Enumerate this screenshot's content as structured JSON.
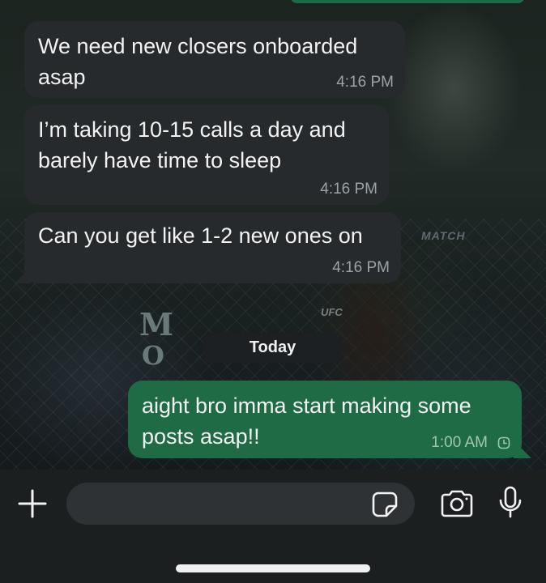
{
  "chat": {
    "messages": [
      {
        "direction": "incoming",
        "text": "We need new closers onboarded\nasap",
        "time": "4:16 PM"
      },
      {
        "direction": "incoming",
        "text": "I’m taking 10-15 calls a day and\nbarely have time to sleep",
        "time": "4:16 PM"
      },
      {
        "direction": "incoming",
        "text": "Can you get like 1-2 new ones on",
        "time": "4:16 PM"
      },
      {
        "direction": "outgoing",
        "text": "aight bro imma start making some\nposts asap!!",
        "time": "1:00 AM",
        "status_icon": "pending-clock-icon"
      }
    ],
    "date_separator": "Today"
  },
  "wallpaper": {
    "text_m": "M",
    "text_o": "O",
    "text_match": "MATCH",
    "text_ufc": "UFC"
  },
  "composer": {
    "input_value": "",
    "plus_icon": "plus-icon",
    "sticker_icon": "sticker-icon",
    "camera_icon": "camera-icon",
    "mic_icon": "microphone-icon"
  },
  "colors": {
    "incoming_bubble": "#262a2c",
    "outgoing_bubble": "#1f6b45",
    "composer_bg": "#1c1f20"
  }
}
